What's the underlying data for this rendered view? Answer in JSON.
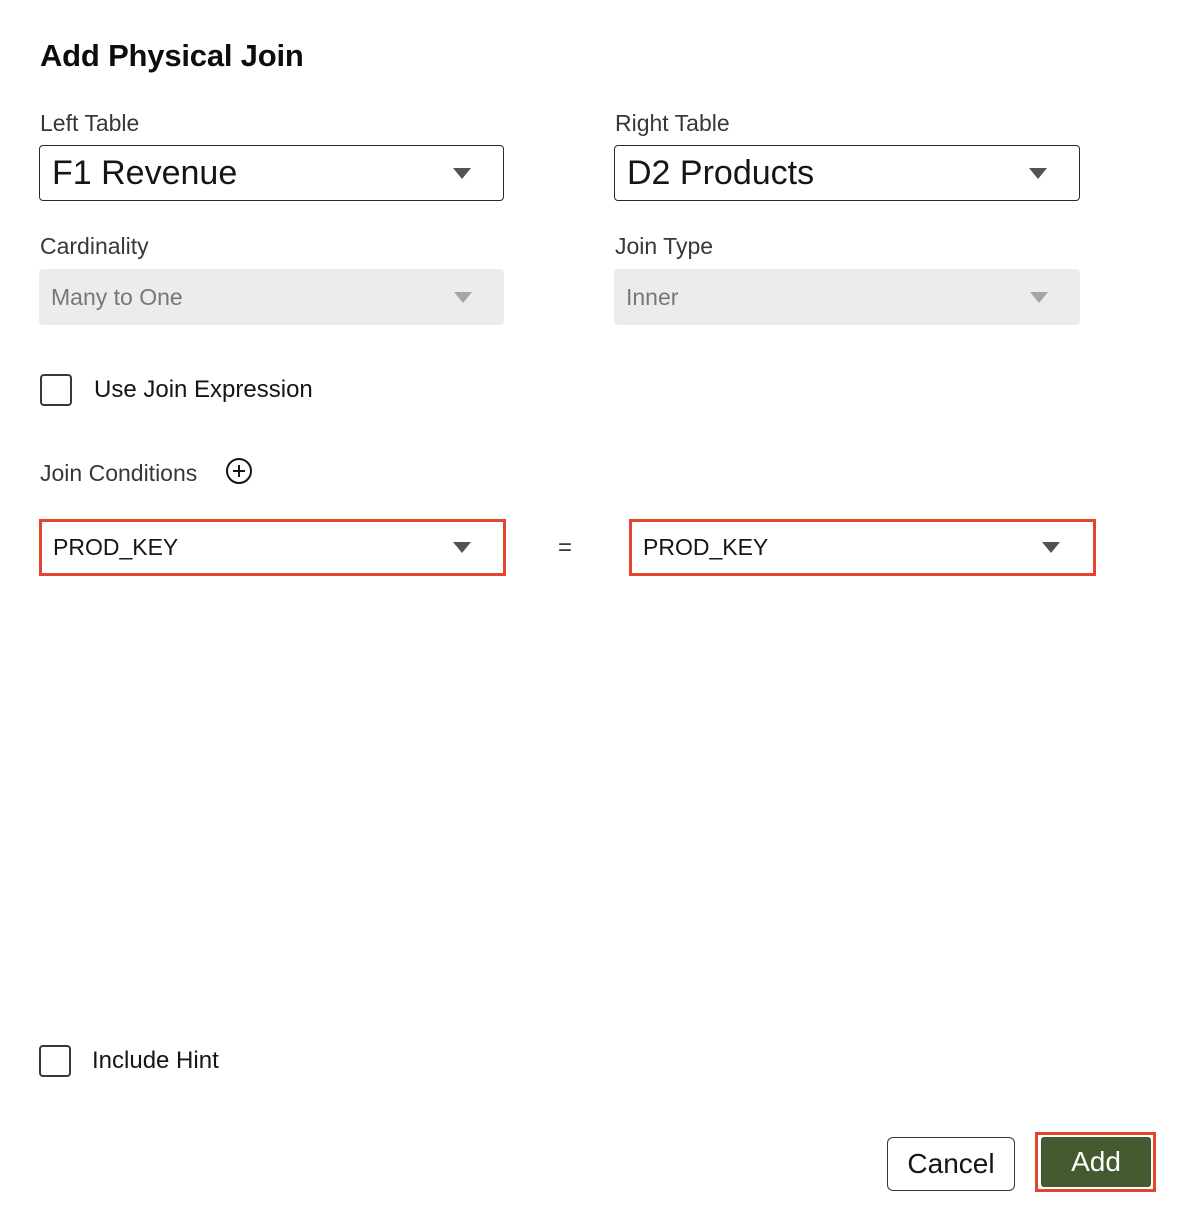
{
  "dialog": {
    "title": "Add Physical Join"
  },
  "left_table": {
    "label": "Left Table",
    "value": "F1 Revenue"
  },
  "right_table": {
    "label": "Right Table",
    "value": "D2 Products"
  },
  "cardinality": {
    "label": "Cardinality",
    "value": "Many to One"
  },
  "join_type": {
    "label": "Join Type",
    "value": "Inner"
  },
  "use_join_expression": {
    "label": "Use Join Expression",
    "checked": false
  },
  "join_conditions": {
    "label": "Join Conditions",
    "add_icon": "add-circle-icon",
    "operator": "=",
    "left_column": "PROD_KEY",
    "right_column": "PROD_KEY"
  },
  "include_hint": {
    "label": "Include Hint",
    "checked": false
  },
  "buttons": {
    "cancel": "Cancel",
    "add": "Add"
  },
  "colors": {
    "primary_button": "#44592f",
    "highlight": "#e5442d",
    "disabled_field": "#ececec"
  }
}
